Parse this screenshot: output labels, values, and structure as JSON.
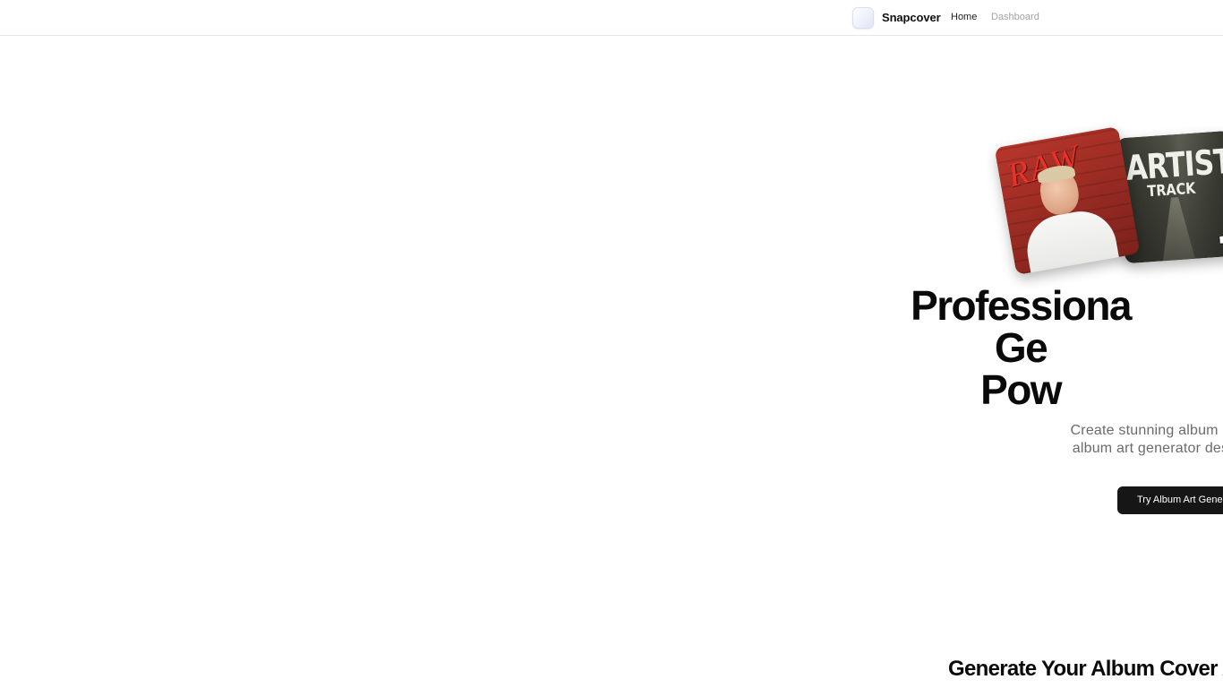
{
  "header": {
    "brand_name": "Snapcover",
    "nav": {
      "home_label": "Home",
      "dashboard_label": "Dashboard"
    }
  },
  "covers": {
    "first_text": "RAW",
    "second_title": "ARTIST",
    "second_subtitle": "TRACK"
  },
  "hero": {
    "title_line1": "Professiona",
    "title_line2": "Ge",
    "title_line3": "Pow",
    "subtitle_line1": "Create stunning album a",
    "subtitle_line2": "album art generator des",
    "cta_label": "Try Album Art Gener"
  },
  "section": {
    "heading": "Generate Your Album Cover Art"
  },
  "colors": {
    "cta_background": "#161616",
    "muted_nav": "#a3a3a3",
    "subtitle_text": "#6b6b6b"
  }
}
